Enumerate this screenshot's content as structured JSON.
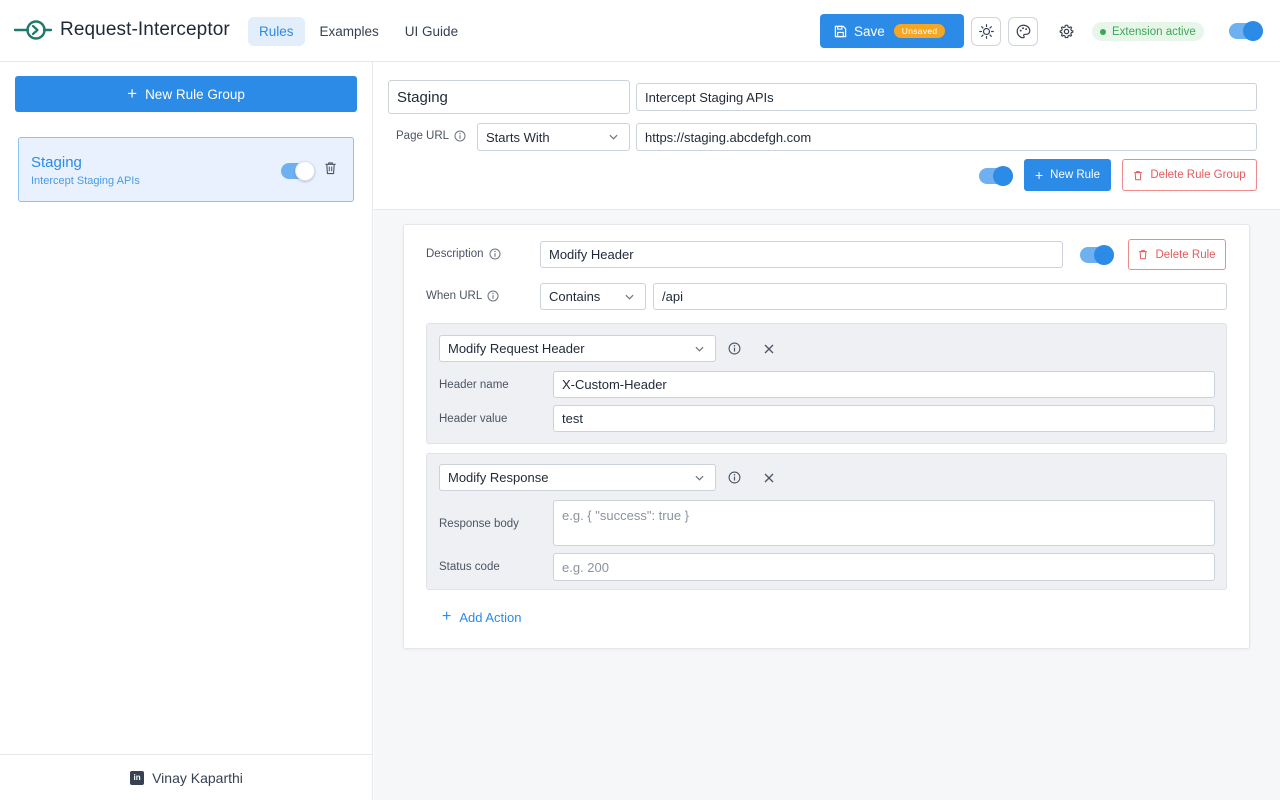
{
  "app": {
    "title": "Request-Interceptor",
    "accent": "#2b8be6"
  },
  "nav": {
    "tabs": [
      {
        "label": "Rules",
        "active": true
      },
      {
        "label": "Examples",
        "active": false
      },
      {
        "label": "UI Guide",
        "active": false
      }
    ]
  },
  "toolbar": {
    "save_label": "Save",
    "save_badge": "Unsaved",
    "theme_icon": "sun-icon",
    "palette_icon": "palette-icon",
    "settings_icon": "gear-icon",
    "status_text": "Extension active",
    "extension_enabled": true
  },
  "sidebar": {
    "new_group_label": "New Rule Group",
    "groups": [
      {
        "name": "Staging",
        "description": "Intercept Staging APIs",
        "enabled": true,
        "selected": true
      }
    ],
    "footer_name": "Vinay Kaparthi",
    "footer_icon": "linkedin-icon"
  },
  "group_editor": {
    "name": "Staging",
    "description": "Intercept Staging APIs",
    "page_url_label": "Page URL",
    "page_url_match": "Starts With",
    "page_url_value": "https://staging.abcdefgh.com",
    "enabled": true,
    "new_rule_label": "New Rule",
    "delete_group_label": "Delete Rule Group"
  },
  "rule": {
    "description_label": "Description",
    "description_value": "Modify Header",
    "enabled": true,
    "delete_label": "Delete Rule",
    "when_url_label": "When URL",
    "when_url_match": "Contains",
    "when_url_value": "/api",
    "actions": [
      {
        "type": "Modify Request Header",
        "fields": [
          {
            "label": "Header name",
            "value": "X-Custom-Header",
            "placeholder": ""
          },
          {
            "label": "Header value",
            "value": "test",
            "placeholder": ""
          }
        ]
      },
      {
        "type": "Modify Response",
        "fields": [
          {
            "label": "Response body",
            "value": "",
            "placeholder": "e.g. { \"success\": true }"
          },
          {
            "label": "Status code",
            "value": "",
            "placeholder": "e.g. 200"
          }
        ]
      }
    ],
    "add_action_label": "Add Action"
  }
}
